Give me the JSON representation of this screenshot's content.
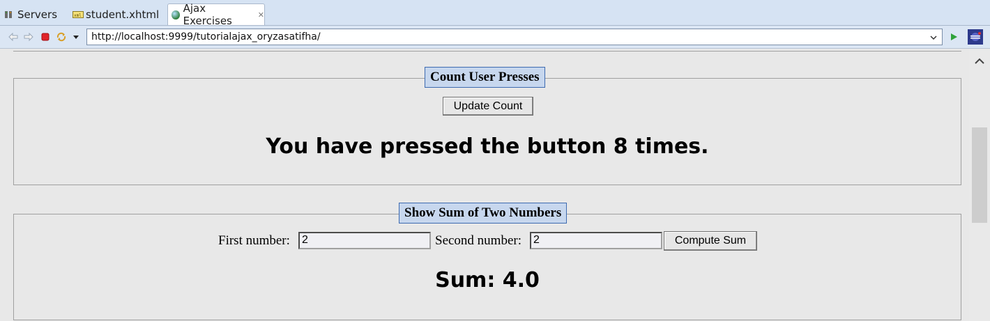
{
  "tabs": [
    {
      "label": "Servers",
      "icon": "servers-icon"
    },
    {
      "label": "student.xhtml",
      "icon": "xhtml-file-icon"
    },
    {
      "label": "Ajax Exercises",
      "icon": "globe-icon",
      "active": true
    }
  ],
  "toolbar": {
    "url": "http://localhost:9999/tutorialajax_oryzasatifha/",
    "buttons": [
      "back-icon",
      "forward-icon",
      "stop-icon",
      "refresh-icon",
      "menu-dropdown-icon",
      "go-icon",
      "eclipse-icon"
    ]
  },
  "count_section": {
    "legend": "Count User Presses",
    "button_label": "Update Count",
    "message": "You have pressed the button 8 times."
  },
  "sum_section": {
    "legend": "Show Sum of Two Numbers",
    "first_label": "First number:",
    "first_value": "2",
    "second_label": "Second number:",
    "second_value": "2",
    "button_label": "Compute Sum",
    "result": "Sum: 4.0"
  },
  "colors": {
    "tab_bar": "#d6e3f3",
    "legend_bg": "#c7d7ee",
    "legend_border": "#3d6ab0",
    "page_bg": "#e8e8e8"
  }
}
